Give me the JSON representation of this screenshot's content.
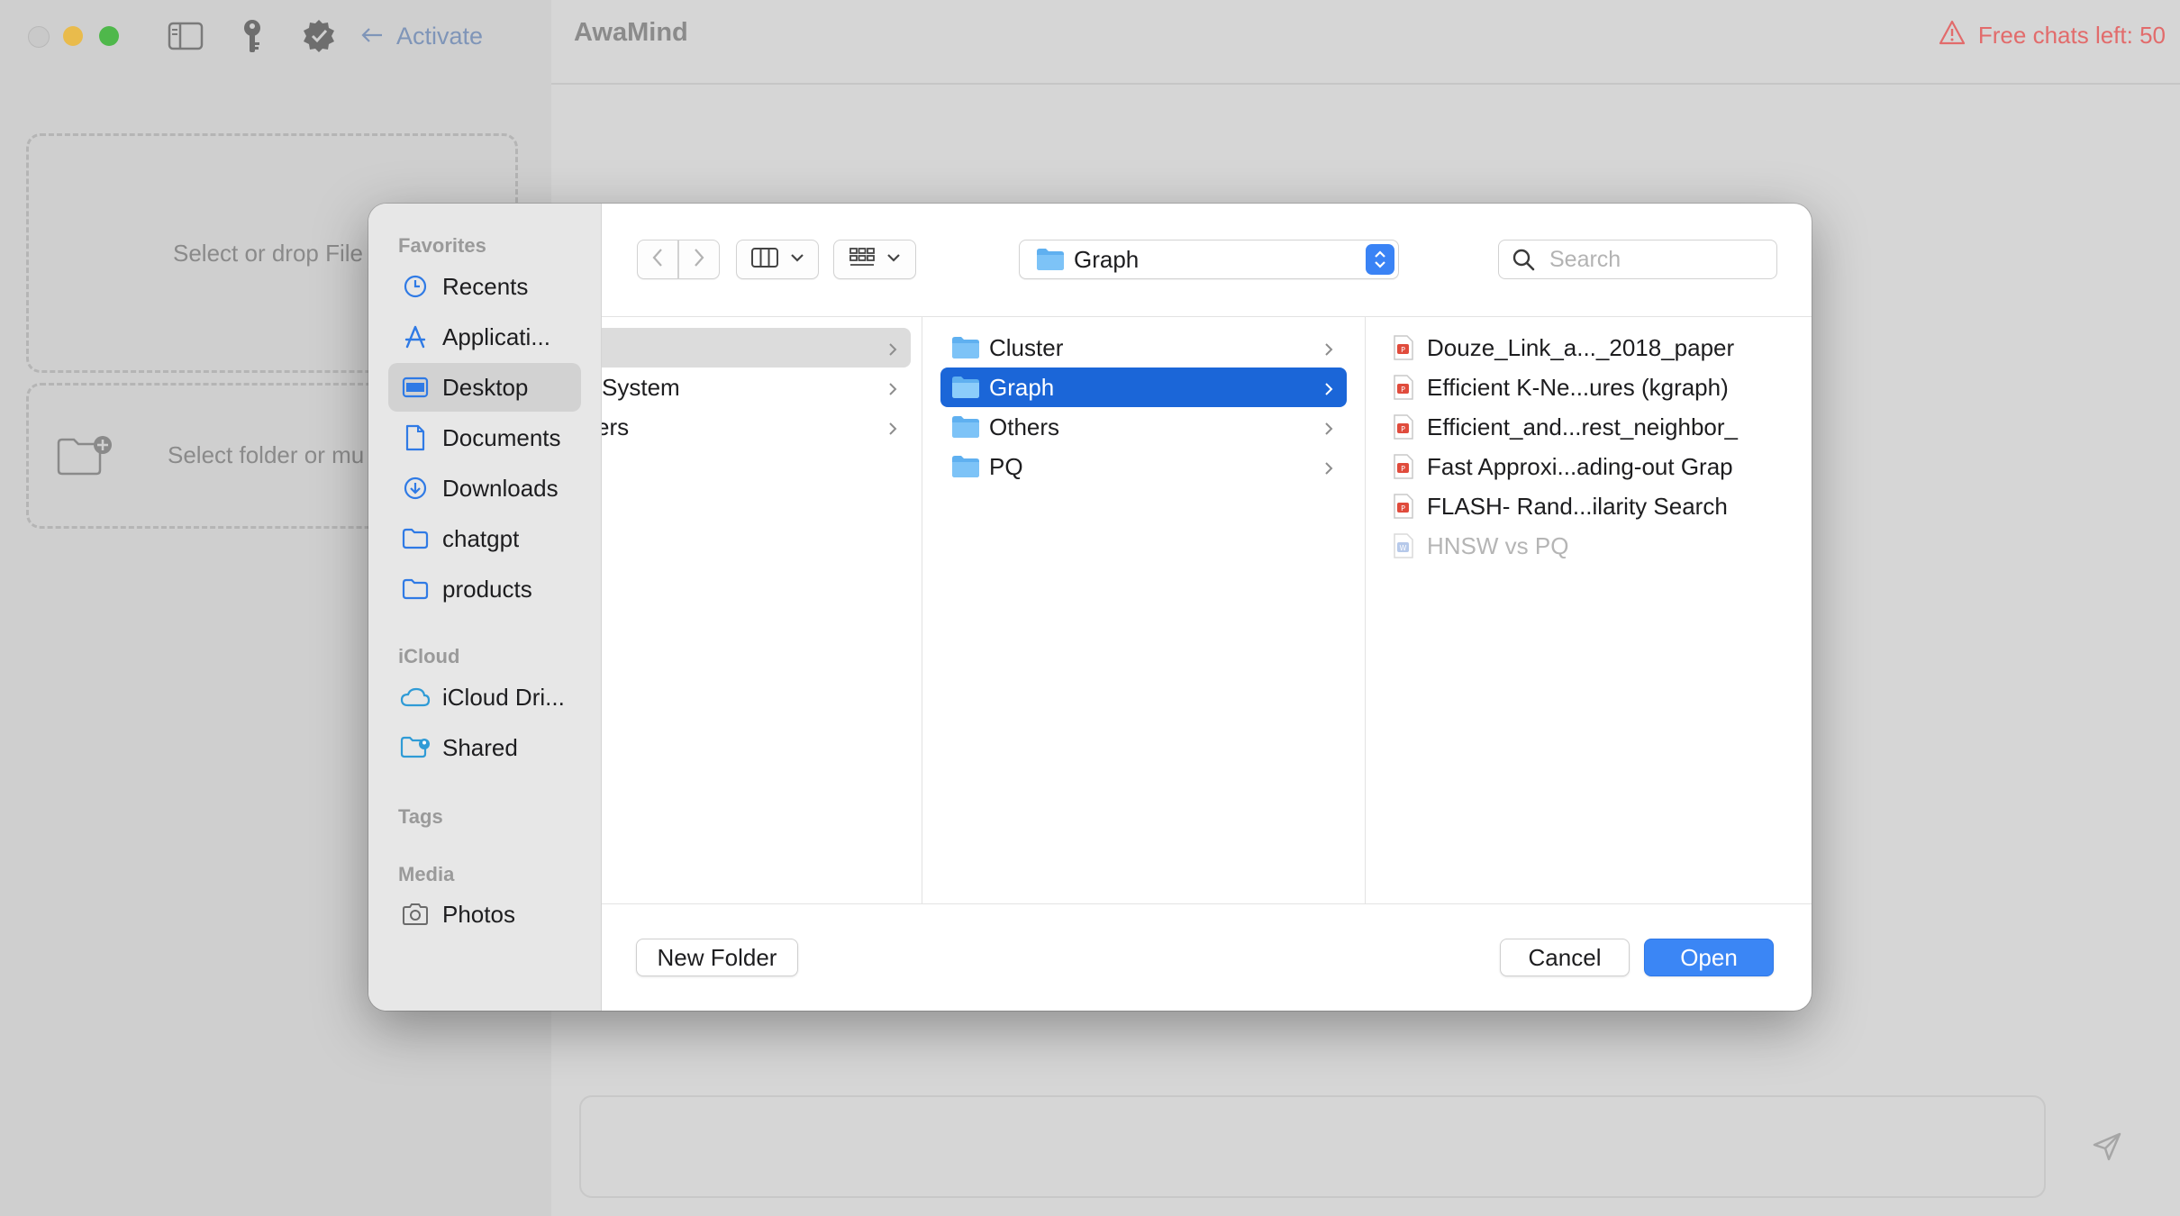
{
  "app": {
    "title": "AwaMind",
    "activate_label": "Activate",
    "free_chats": "Free chats left: 50",
    "drop_files": "Select or drop File",
    "drop_folder": "Select folder or mu",
    "colors": {
      "accent": "#3b86f5",
      "warning": "#e26b6b",
      "selection": "#1b66d8"
    }
  },
  "dialog": {
    "toolbar": {
      "path_label": "Graph",
      "search_placeholder": "Search",
      "icons": [
        "back-icon",
        "forward-icon",
        "column-view-icon",
        "group-grid-icon",
        "chevron-down-icon"
      ]
    },
    "sidebar": {
      "sections": [
        {
          "title": "Favorites",
          "items": [
            {
              "label": "Recents",
              "icon": "clock-icon"
            },
            {
              "label": "Applicati...",
              "icon": "applications-icon"
            },
            {
              "label": "Desktop",
              "icon": "desktop-icon",
              "selected": true
            },
            {
              "label": "Documents",
              "icon": "document-icon"
            },
            {
              "label": "Downloads",
              "icon": "download-icon"
            },
            {
              "label": "chatgpt",
              "icon": "folder-icon"
            },
            {
              "label": "products",
              "icon": "folder-icon"
            }
          ]
        },
        {
          "title": "iCloud",
          "items": [
            {
              "label": "iCloud Dri...",
              "icon": "cloud-icon"
            },
            {
              "label": "Shared",
              "icon": "shared-folder-icon"
            }
          ]
        },
        {
          "title": "Tags",
          "items": []
        },
        {
          "title": "Media",
          "items": [
            {
              "label": "Photos",
              "icon": "camera-icon"
            }
          ]
        }
      ]
    },
    "columns": {
      "col1": [
        "",
        "System",
        "ers"
      ],
      "col2": [
        "Cluster",
        "Graph",
        "Others",
        "PQ"
      ],
      "col3": [
        "Douze_Link_a..._2018_paper",
        "Efficient K-Ne...ures (kgraph)",
        "Efficient_and...rest_neighbor_",
        "Fast Approxi...ading-out Grap",
        "FLASH- Rand...ilarity Search",
        "HNSW vs PQ"
      ]
    },
    "buttons": {
      "new_folder": "New Folder",
      "cancel": "Cancel",
      "open": "Open"
    }
  }
}
